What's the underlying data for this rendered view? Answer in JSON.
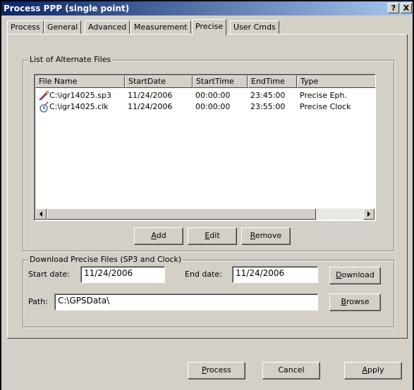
{
  "window": {
    "title": "Process PPP (single point)",
    "help_button": "?",
    "close_button": "X"
  },
  "tabs": [
    {
      "label": "Process",
      "active": false
    },
    {
      "label": "General",
      "active": false
    },
    {
      "label": "Advanced",
      "active": false
    },
    {
      "label": "Measurement",
      "active": false
    },
    {
      "label": "Precise",
      "active": true
    },
    {
      "label": "User Cmds",
      "active": false
    }
  ],
  "alternate_files": {
    "group_label": "List of Alternate Files",
    "columns": [
      "File Name",
      "StartDate",
      "StartTime",
      "EndTime",
      "Type"
    ],
    "rows": [
      {
        "icon": "satellite-ephemeris-icon",
        "file": "C:\\igr14025.sp3",
        "start_date": "11/24/2006",
        "start_time": "00:00:00",
        "end_time": "23:45:00",
        "type": "Precise Eph."
      },
      {
        "icon": "satellite-clock-icon",
        "file": "C:\\igr14025.clk",
        "start_date": "11/24/2006",
        "start_time": "00:00:00",
        "end_time": "23:55:00",
        "type": "Precise Clock"
      }
    ],
    "buttons": {
      "add": {
        "mnemonic": "A",
        "rest": "dd"
      },
      "edit": {
        "mnemonic": "E",
        "rest": "dit"
      },
      "remove": {
        "mnemonic": "R",
        "rest": "emove"
      }
    }
  },
  "download": {
    "group_label": "Download Precise Files (SP3 and Clock)",
    "start_date_label": "Start date:",
    "start_date_value": "11/24/2006",
    "end_date_label": "End date:",
    "end_date_value": "11/24/2006",
    "download_button": {
      "mnemonic": "D",
      "rest": "ownload"
    },
    "path_label": "Path:",
    "path_value": "C:\\GPSData\\",
    "browse_button": {
      "mnemonic": "B",
      "rest": "rowse"
    }
  },
  "footer": {
    "process_button": {
      "mnemonic": "P",
      "rest": "rocess"
    },
    "cancel_button": "Cancel",
    "apply_button": {
      "mnemonic": "A",
      "rest": "pply"
    }
  }
}
